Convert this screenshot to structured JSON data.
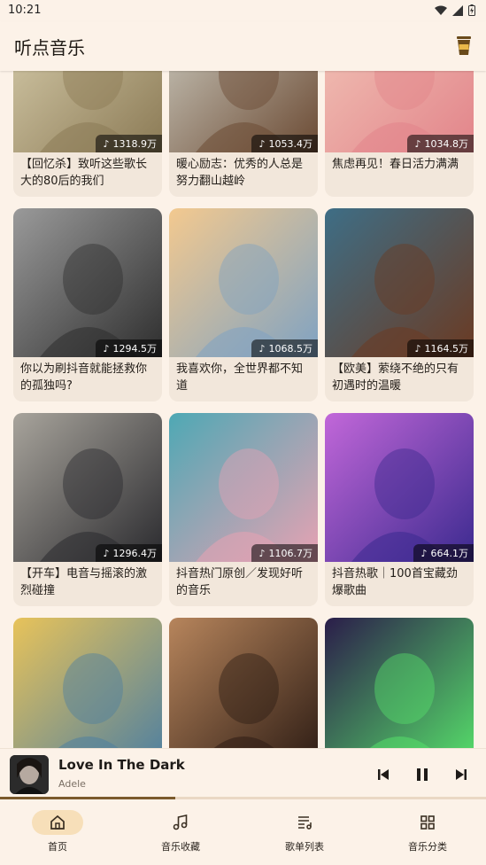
{
  "status": {
    "time": "10:21"
  },
  "app": {
    "title": "听点音乐"
  },
  "playlists": [
    {
      "title": "【回忆杀】致听这些歌长大的80后的我们",
      "plays": "1318.9万",
      "art": "bicycle",
      "c1": "#d9cfae",
      "c2": "#8b7a55"
    },
    {
      "title": "暖心励志：优秀的人总是努力翻山越岭",
      "plays": "1053.4万",
      "art": "figure",
      "c1": "#cfcfc4",
      "c2": "#6b4a33"
    },
    {
      "title": "焦虑再见！春日活力满满",
      "plays": "1034.8万",
      "art": "girl-headphones",
      "c1": "#f2c6b8",
      "c2": "#e2848a"
    },
    {
      "title": "你以为刷抖音就能拯救你的孤独吗?",
      "plays": "1294.5万",
      "art": "kids-bw",
      "c1": "#9a9a9a",
      "c2": "#2e2e2e"
    },
    {
      "title": "我喜欢你，全世界都不知道",
      "plays": "1068.5万",
      "art": "kiss",
      "c1": "#f3c98f",
      "c2": "#7fa2c2"
    },
    {
      "title": "【欧美】萦绕不绝的只有初遇时的温暖",
      "plays": "1164.5万",
      "art": "portrait",
      "c1": "#3e6e86",
      "c2": "#6b3a22"
    },
    {
      "title": "【开车】电音与摇滚的激烈碰撞",
      "plays": "1296.4万",
      "art": "car",
      "c1": "#a8a49c",
      "c2": "#2a2a2e"
    },
    {
      "title": "抖音热门原创／发现好听的音乐",
      "plays": "1106.7万",
      "art": "anime-boy",
      "c1": "#4ea8b4",
      "c2": "#e7a2b3"
    },
    {
      "title": "抖音热歌｜100首宝藏劲爆歌曲",
      "plays": "664.1万",
      "art": "neon-girl",
      "c1": "#c267d9",
      "c2": "#3b2a8f"
    },
    {
      "title": "",
      "plays": "",
      "art": "sitting-man",
      "c1": "#e8c35a",
      "c2": "#4e7fa0"
    },
    {
      "title": "",
      "plays": "",
      "art": "blinds",
      "c1": "#b7855c",
      "c2": "#2d1c14"
    },
    {
      "title": "",
      "plays": "",
      "art": "dj",
      "c1": "#2b1d4a",
      "c2": "#56e06a"
    }
  ],
  "player": {
    "song": "Love In The Dark",
    "artist": "Adele",
    "progress": 0.36
  },
  "nav": [
    {
      "label": "首页",
      "icon": "home-icon",
      "active": true
    },
    {
      "label": "音乐收藏",
      "icon": "music-notes-icon",
      "active": false
    },
    {
      "label": "歌单列表",
      "icon": "playlist-icon",
      "active": false
    },
    {
      "label": "音乐分类",
      "icon": "grid-icon",
      "active": false
    }
  ],
  "colors": {
    "background": "#fcf2e8",
    "card": "#f2e7db",
    "accent": "#7b5a2c",
    "nav_active": "#f7dfb9"
  }
}
